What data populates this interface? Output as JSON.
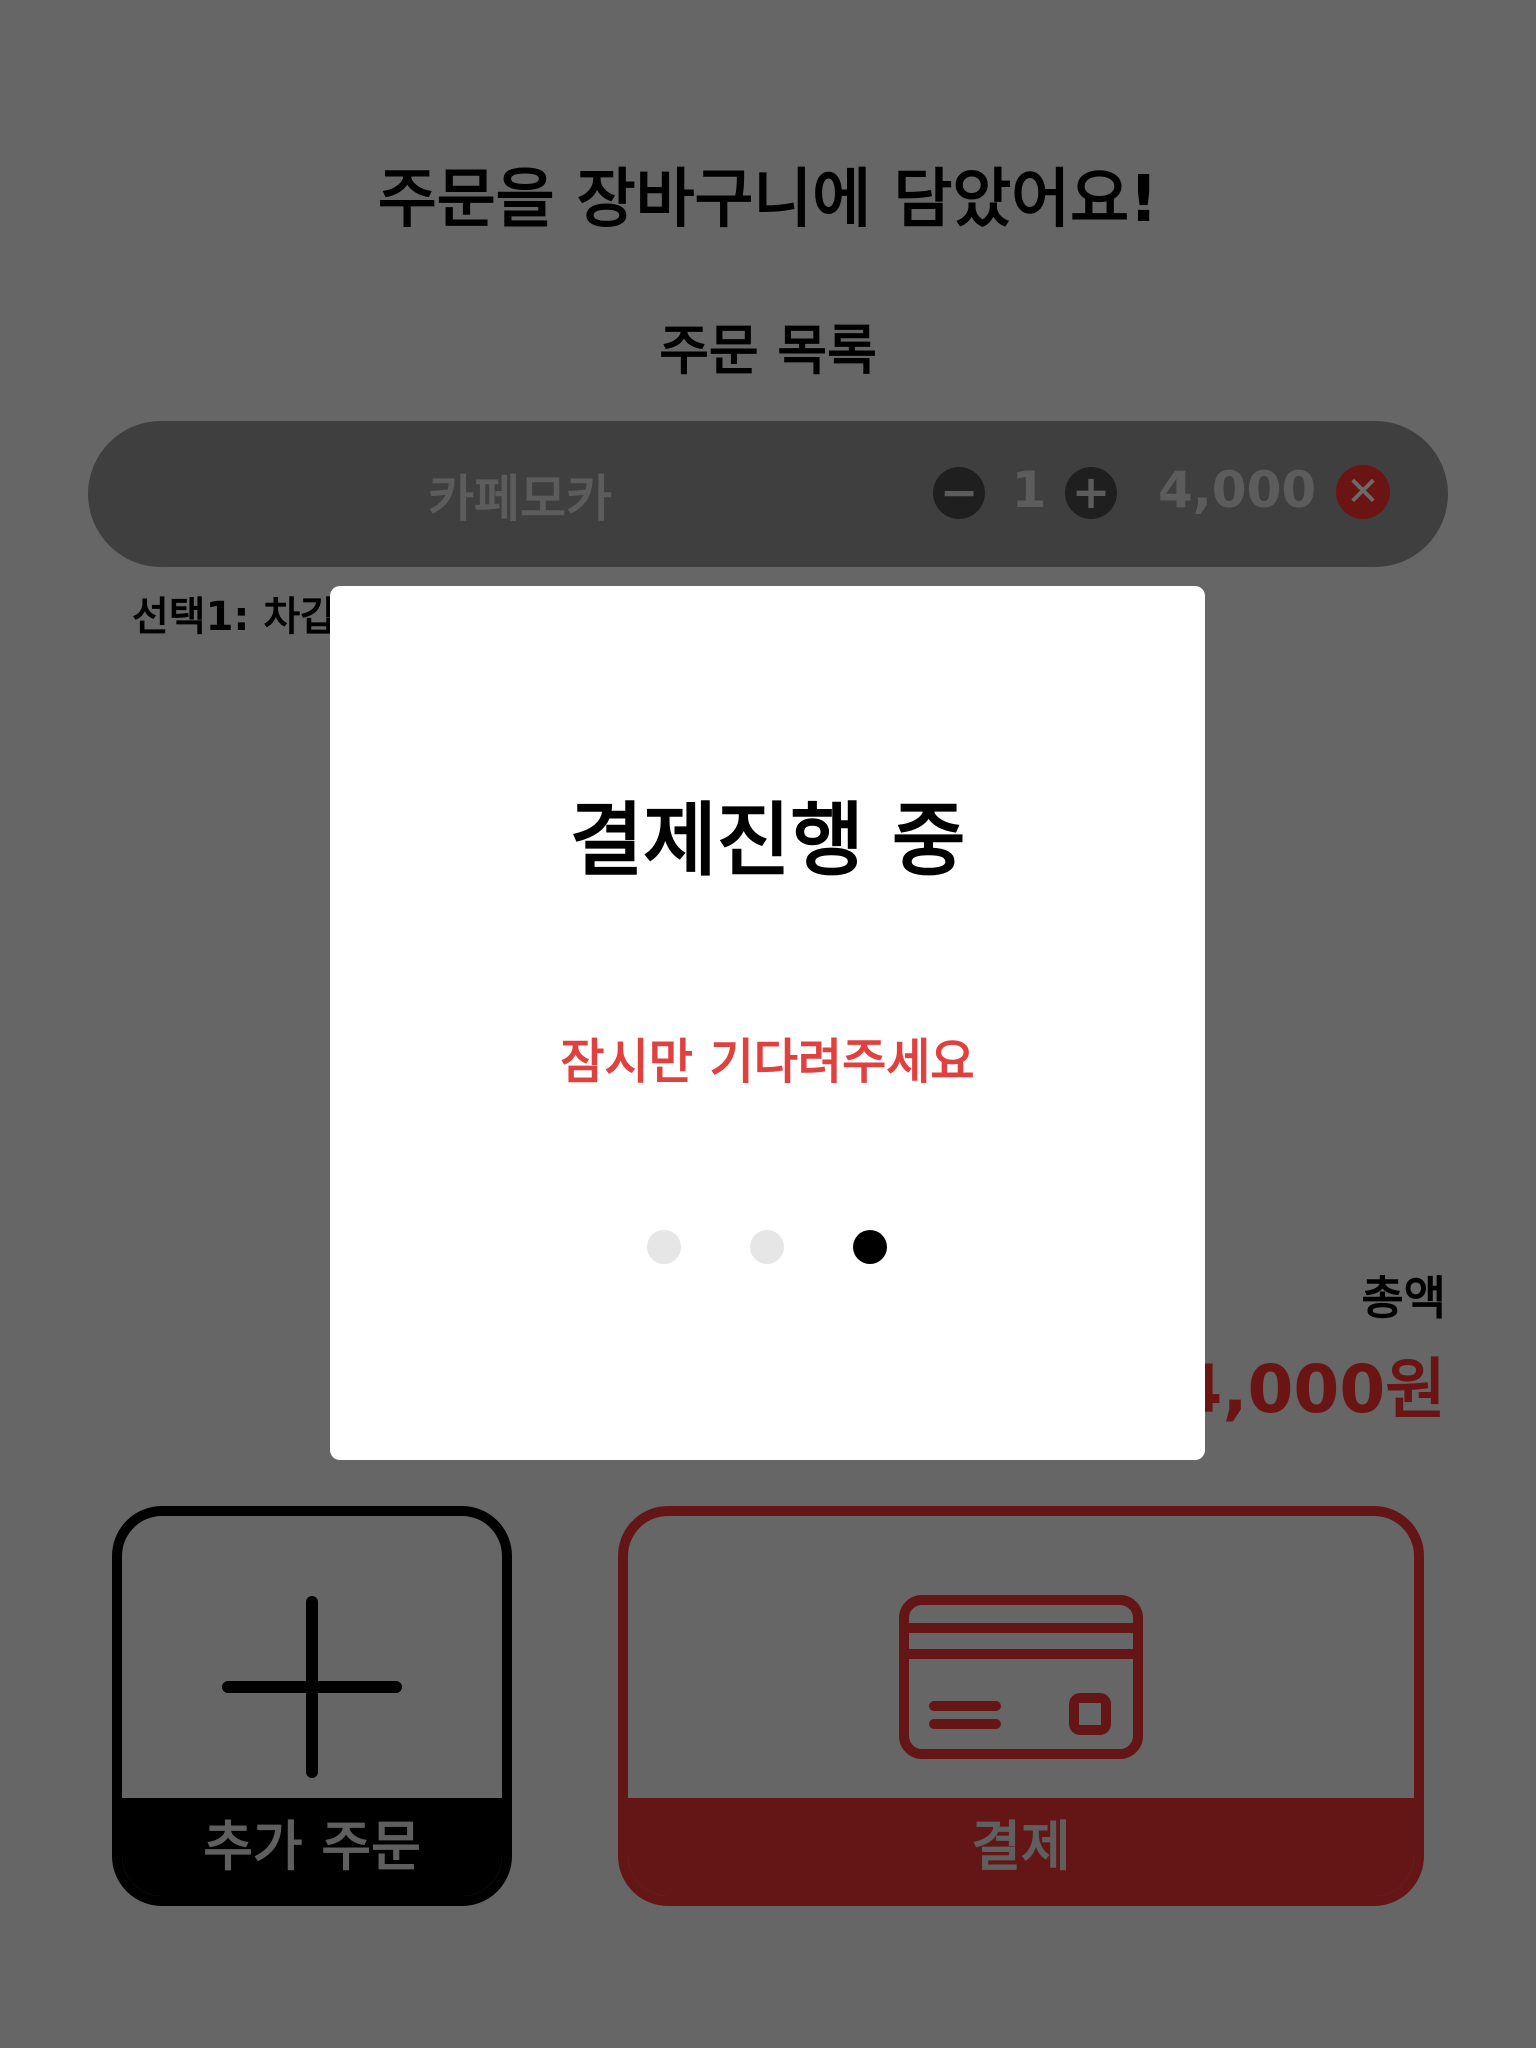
{
  "header": {
    "title": "주문을 장바구니에 담았어요!",
    "subtitle": "주문 목록"
  },
  "order_items": [
    {
      "name": "카페모카",
      "quantity": "1",
      "price": "4,000",
      "option": "선택1: 차갑"
    }
  ],
  "totals": {
    "label": "총액",
    "value": "4,000원"
  },
  "actions": {
    "add_label": "추가 주문",
    "pay_label": "결제"
  },
  "modal": {
    "title": "결제진행 중",
    "message": "잠시만 기다려주세요",
    "loading_dots": 3,
    "active_dot": 3
  },
  "icons": {
    "decrease": "minus-icon",
    "increase": "plus-icon",
    "remove": "close-icon",
    "add_order": "plus-icon",
    "payment": "credit-card-icon"
  },
  "colors": {
    "accent_red": "#e0413f",
    "pay_dark_red": "#641616",
    "overlay_gray": "#666666"
  }
}
